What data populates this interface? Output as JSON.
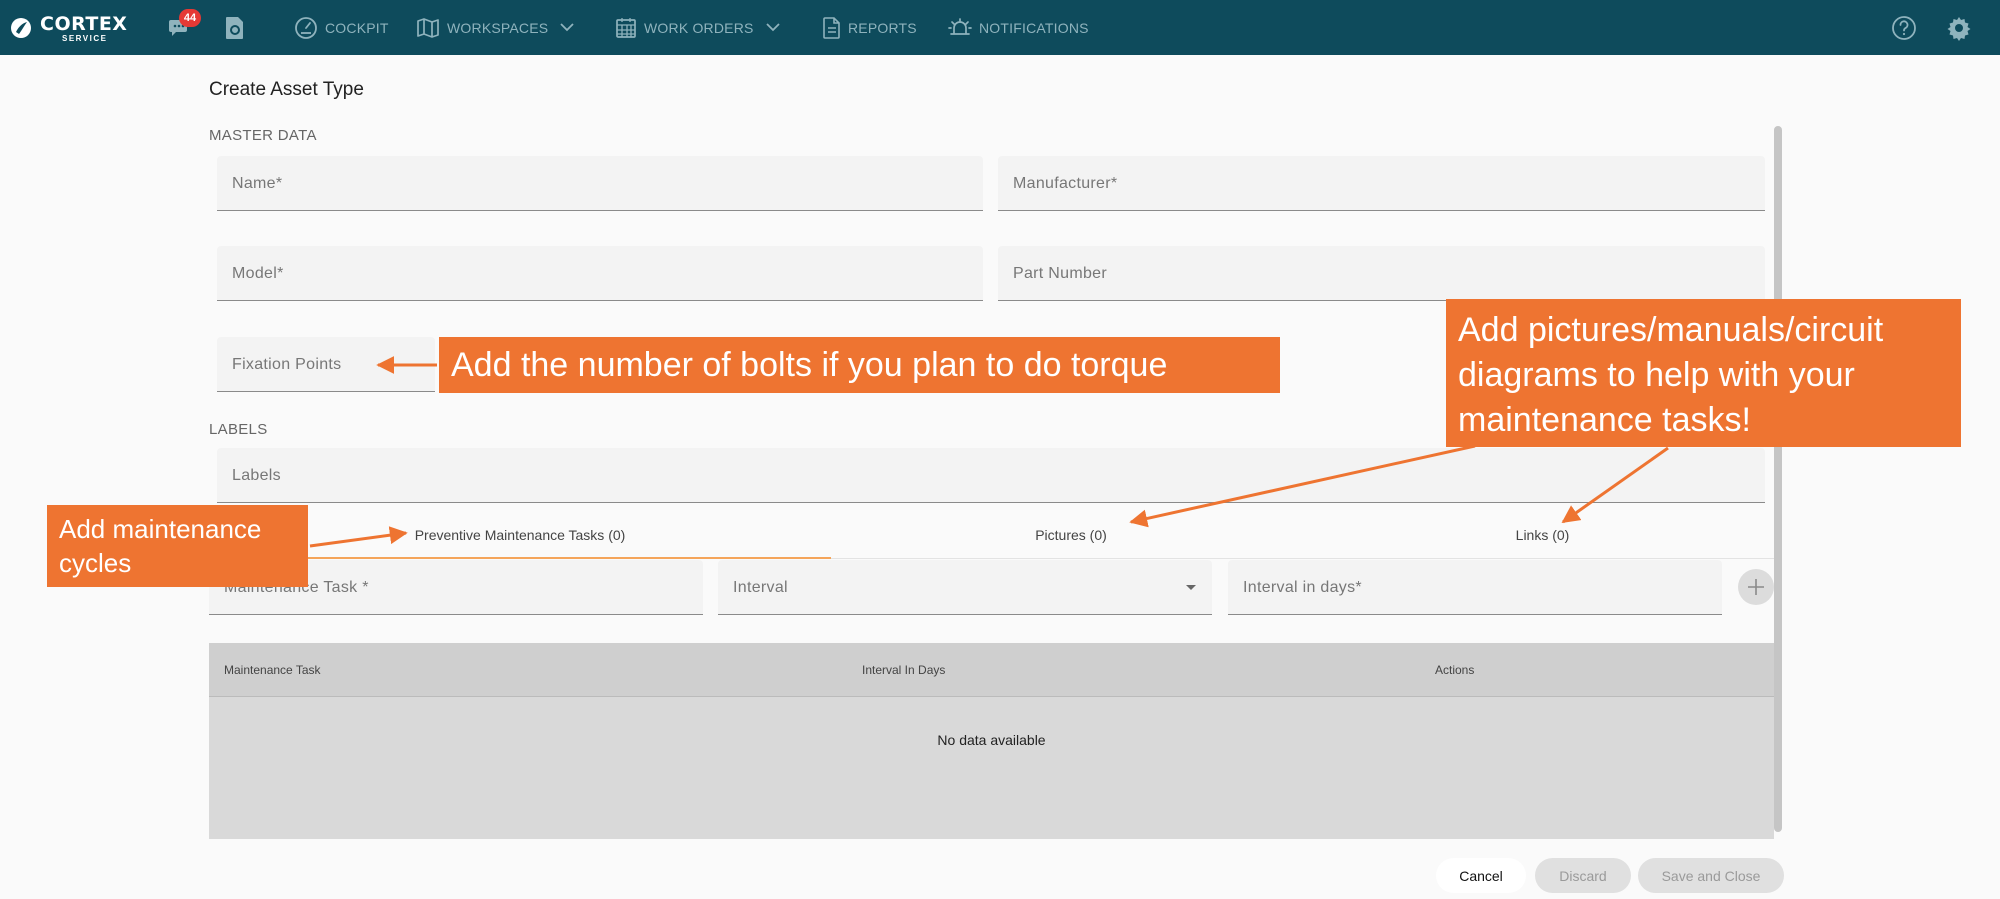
{
  "topbar": {
    "logo_word": "CORTEX",
    "logo_sub": "SERVICE",
    "chat_badge": "44",
    "nav": [
      {
        "label": "COCKPIT",
        "icon": "gauge-icon"
      },
      {
        "label": "WORKSPACES",
        "icon": "map-icon"
      },
      {
        "label": "WORK ORDERS",
        "icon": "calendar-icon"
      },
      {
        "label": "REPORTS",
        "icon": "document-icon"
      },
      {
        "label": "NOTIFICATIONS",
        "icon": "alarm-icon"
      }
    ]
  },
  "form": {
    "title": "Create Asset Type",
    "master_data_label": "MASTER DATA",
    "name_placeholder": "Name*",
    "manufacturer_placeholder": "Manufacturer*",
    "model_placeholder": "Model*",
    "part_number_placeholder": "Part Number",
    "fixation_points_placeholder": "Fixation Points",
    "labels_section": "LABELS",
    "labels_placeholder": "Labels"
  },
  "tabs": [
    {
      "label": "Preventive Maintenance Tasks (0)",
      "active": true
    },
    {
      "label": "Pictures (0)",
      "active": false
    },
    {
      "label": "Links (0)",
      "active": false
    }
  ],
  "maintenance": {
    "task_placeholder": "Maintenance Task *",
    "interval_placeholder": "Interval",
    "interval_days_placeholder": "Interval in days*"
  },
  "table": {
    "columns": [
      "Maintenance Task",
      "Interval In Days",
      "Actions"
    ],
    "empty_text": "No data available"
  },
  "buttons": {
    "cancel": "Cancel",
    "discard": "Discard",
    "save_close": "Save and Close"
  },
  "callouts": {
    "bolts": "Add the number of bolts if you plan to do torque",
    "pictures": "Add pictures/manuals/circuit diagrams to help with your maintenance tasks!",
    "cycles": "Add maintenance cycles"
  },
  "colors": {
    "topbar": "#0e4b5c",
    "callout": "#ee7431",
    "tab_active_line": "#f5a55a",
    "badge": "#e53935"
  }
}
